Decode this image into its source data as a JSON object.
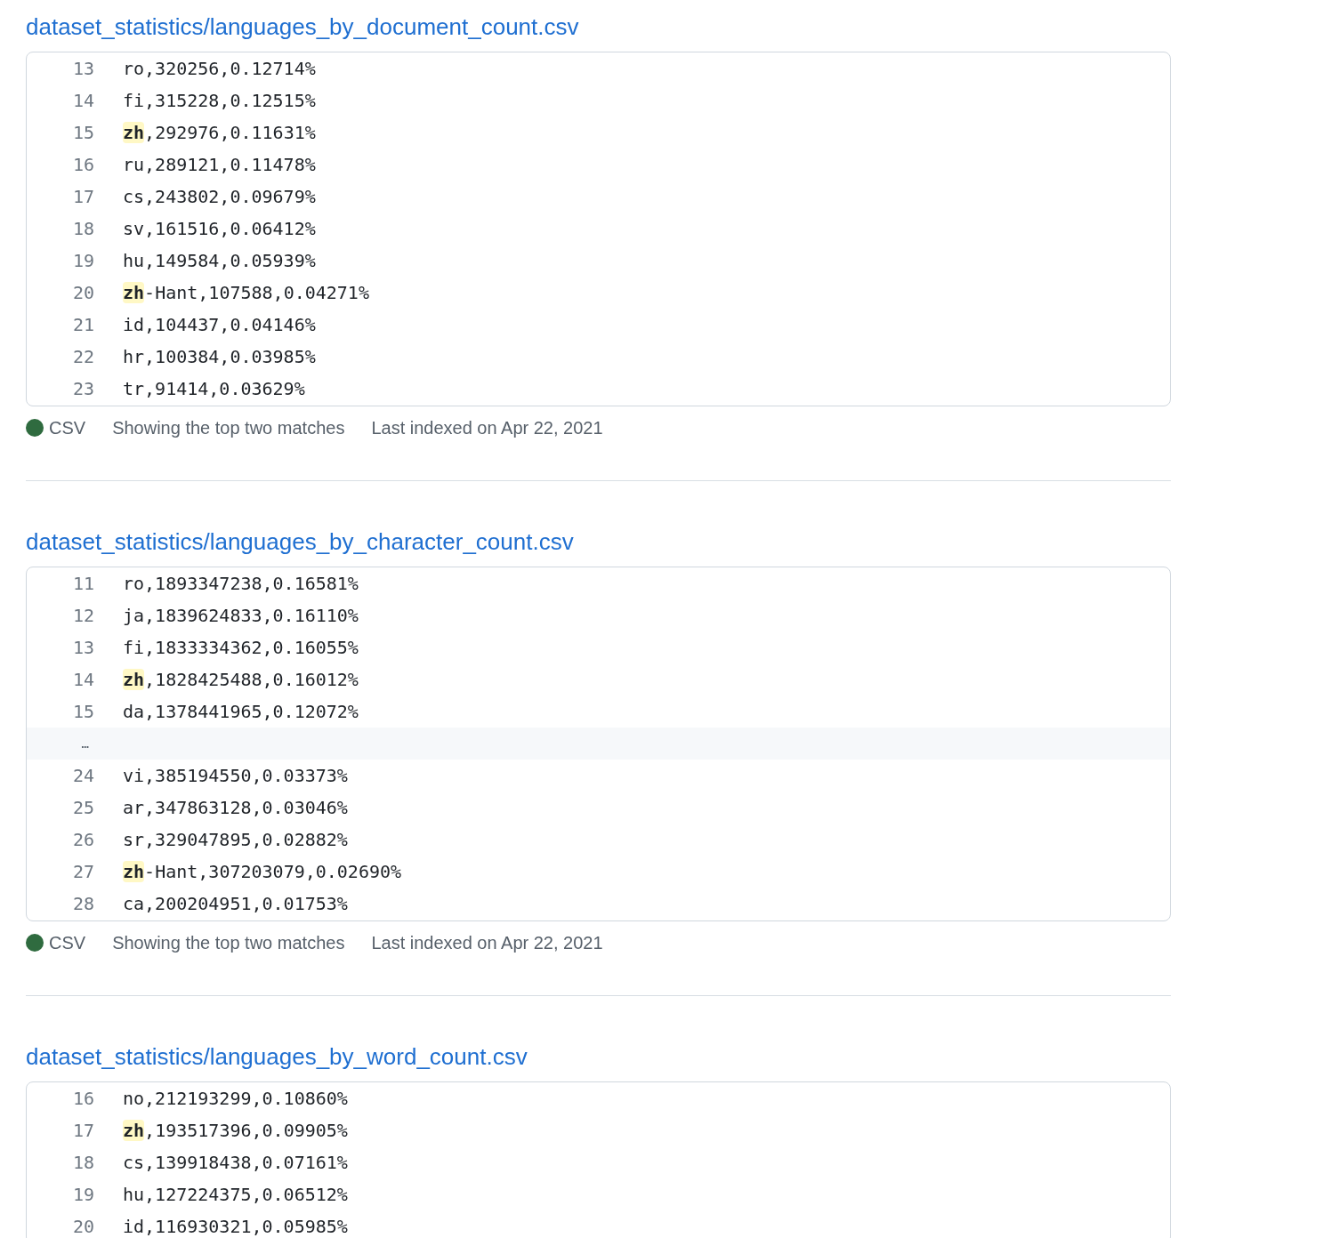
{
  "results": [
    {
      "path": "dataset_statistics/languages_by_document_count.csv",
      "language": {
        "name": "CSV",
        "color": "#2f6b3f"
      },
      "summary": "Showing the top two matches",
      "indexed": "Last indexed on Apr 22, 2021",
      "lines": [
        {
          "kind": "line",
          "number": "13",
          "code": [
            {
              "text": "ro,320256,0.12714%",
              "match": false
            }
          ]
        },
        {
          "kind": "line",
          "number": "14",
          "code": [
            {
              "text": "fi,315228,0.12515%",
              "match": false
            }
          ]
        },
        {
          "kind": "line",
          "number": "15",
          "code": [
            {
              "text": "zh",
              "match": true
            },
            {
              "text": ",292976,0.11631%",
              "match": false
            }
          ]
        },
        {
          "kind": "line",
          "number": "16",
          "code": [
            {
              "text": "ru,289121,0.11478%",
              "match": false
            }
          ]
        },
        {
          "kind": "line",
          "number": "17",
          "code": [
            {
              "text": "cs,243802,0.09679%",
              "match": false
            }
          ]
        },
        {
          "kind": "line",
          "number": "18",
          "code": [
            {
              "text": "sv,161516,0.06412%",
              "match": false
            }
          ]
        },
        {
          "kind": "line",
          "number": "19",
          "code": [
            {
              "text": "hu,149584,0.05939%",
              "match": false
            }
          ]
        },
        {
          "kind": "line",
          "number": "20",
          "code": [
            {
              "text": "zh",
              "match": true
            },
            {
              "text": "-Hant,107588,0.04271%",
              "match": false
            }
          ]
        },
        {
          "kind": "line",
          "number": "21",
          "code": [
            {
              "text": "id,104437,0.04146%",
              "match": false
            }
          ]
        },
        {
          "kind": "line",
          "number": "22",
          "code": [
            {
              "text": "hr,100384,0.03985%",
              "match": false
            }
          ]
        },
        {
          "kind": "line",
          "number": "23",
          "code": [
            {
              "text": "tr,91414,0.03629%",
              "match": false
            }
          ]
        }
      ]
    },
    {
      "path": "dataset_statistics/languages_by_character_count.csv",
      "language": {
        "name": "CSV",
        "color": "#2f6b3f"
      },
      "summary": "Showing the top two matches",
      "indexed": "Last indexed on Apr 22, 2021",
      "lines": [
        {
          "kind": "line",
          "number": "11",
          "code": [
            {
              "text": "ro,1893347238,0.16581%",
              "match": false
            }
          ]
        },
        {
          "kind": "line",
          "number": "12",
          "code": [
            {
              "text": "ja,1839624833,0.16110%",
              "match": false
            }
          ]
        },
        {
          "kind": "line",
          "number": "13",
          "code": [
            {
              "text": "fi,1833334362,0.16055%",
              "match": false
            }
          ]
        },
        {
          "kind": "line",
          "number": "14",
          "code": [
            {
              "text": "zh",
              "match": true
            },
            {
              "text": ",1828425488,0.16012%",
              "match": false
            }
          ]
        },
        {
          "kind": "line",
          "number": "15",
          "code": [
            {
              "text": "da,1378441965,0.12072%",
              "match": false
            }
          ]
        },
        {
          "kind": "gap",
          "number": "…"
        },
        {
          "kind": "line",
          "number": "24",
          "code": [
            {
              "text": "vi,385194550,0.03373%",
              "match": false
            }
          ]
        },
        {
          "kind": "line",
          "number": "25",
          "code": [
            {
              "text": "ar,347863128,0.03046%",
              "match": false
            }
          ]
        },
        {
          "kind": "line",
          "number": "26",
          "code": [
            {
              "text": "sr,329047895,0.02882%",
              "match": false
            }
          ]
        },
        {
          "kind": "line",
          "number": "27",
          "code": [
            {
              "text": "zh",
              "match": true
            },
            {
              "text": "-Hant,307203079,0.02690%",
              "match": false
            }
          ]
        },
        {
          "kind": "line",
          "number": "28",
          "code": [
            {
              "text": "ca,200204951,0.01753%",
              "match": false
            }
          ]
        }
      ]
    },
    {
      "path": "dataset_statistics/languages_by_word_count.csv",
      "lines": [
        {
          "kind": "line",
          "number": "16",
          "code": [
            {
              "text": "no,212193299,0.10860%",
              "match": false
            }
          ]
        },
        {
          "kind": "line",
          "number": "17",
          "code": [
            {
              "text": "zh",
              "match": true
            },
            {
              "text": ",193517396,0.09905%",
              "match": false
            }
          ]
        },
        {
          "kind": "line",
          "number": "18",
          "code": [
            {
              "text": "cs,139918438,0.07161%",
              "match": false
            }
          ]
        },
        {
          "kind": "line",
          "number": "19",
          "code": [
            {
              "text": "hu,127224375,0.06512%",
              "match": false
            }
          ]
        },
        {
          "kind": "line",
          "number": "20",
          "code": [
            {
              "text": "id,116930321,0.05985%",
              "match": false
            }
          ]
        }
      ]
    }
  ]
}
